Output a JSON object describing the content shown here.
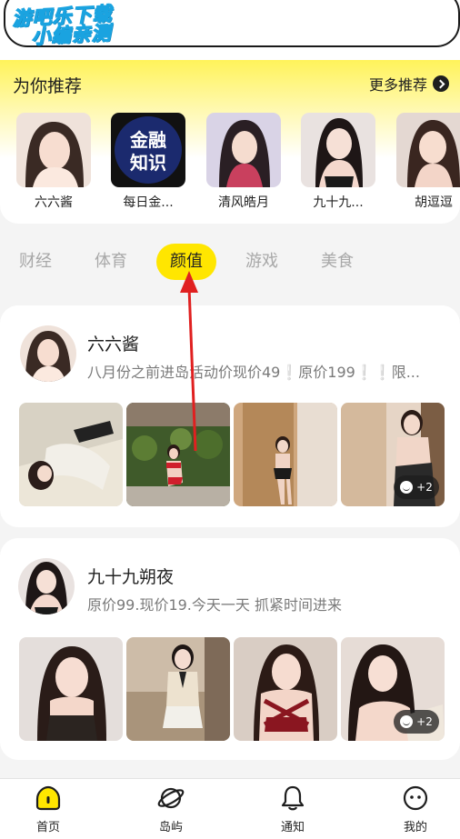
{
  "watermark": {
    "line1": "游吧乐下载",
    "line2": "小编亲测"
  },
  "recommend": {
    "title": "为你推荐",
    "more_label": "更多推荐",
    "items": [
      {
        "name": "六六酱"
      },
      {
        "name": "每日金...",
        "logo_text": "金融知识"
      },
      {
        "name": "清风皓月"
      },
      {
        "name": "九十九..."
      },
      {
        "name": "胡逗逗"
      }
    ]
  },
  "tabs": [
    {
      "label": "财经"
    },
    {
      "label": "体育"
    },
    {
      "label": "颜值",
      "active": true
    },
    {
      "label": "游戏"
    },
    {
      "label": "美食"
    }
  ],
  "feed": [
    {
      "name": "六六酱",
      "desc_parts": [
        "八月份之前进岛活动价现价49",
        "❕",
        "原价199",
        "❕",
        "❕",
        "限..."
      ],
      "more_count": "+2"
    },
    {
      "name": "九十九朔夜",
      "desc": "原价99.现价19.今天一天 抓紧时间进来",
      "more_count": "+2"
    }
  ],
  "nav": {
    "items": [
      {
        "label": "首页",
        "icon": "home-icon",
        "active": true
      },
      {
        "label": "岛屿",
        "icon": "planet-icon"
      },
      {
        "label": "通知",
        "icon": "bell-icon"
      },
      {
        "label": "我的",
        "icon": "profile-face-icon"
      }
    ]
  },
  "colors": {
    "accent": "#ffe600",
    "annotation": "#e02020",
    "highlight": "#18b5f5"
  }
}
